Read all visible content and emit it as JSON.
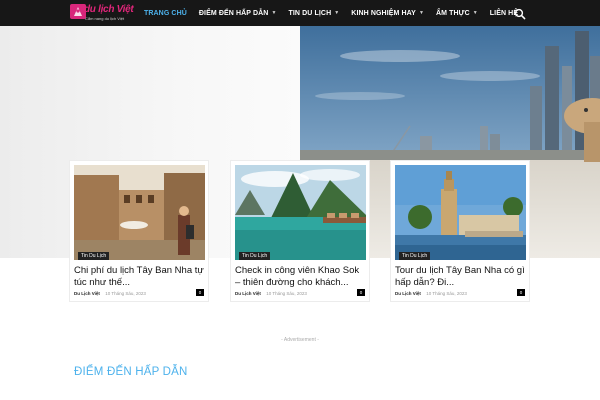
{
  "header": {
    "logo": {
      "name": "du lịch Việt",
      "tagline": "Cẩm nang du lịch Việt"
    },
    "menu": [
      {
        "label": "TRANG CHỦ",
        "active": true,
        "has_dropdown": false
      },
      {
        "label": "ĐIỂM ĐẾN HẤP DẪN",
        "active": false,
        "has_dropdown": true
      },
      {
        "label": "TIN DU LỊCH",
        "active": false,
        "has_dropdown": true
      },
      {
        "label": "KINH NGHIỆM HAY",
        "active": false,
        "has_dropdown": true
      },
      {
        "label": "ẨM THỰC",
        "active": false,
        "has_dropdown": true
      },
      {
        "label": "LIÊN HỆ",
        "active": false,
        "has_dropdown": false
      }
    ],
    "search_icon": "search-icon"
  },
  "cards": [
    {
      "category": "Tin Du Lịch",
      "title": "Chi phí du lịch Tây Ban Nha tự túc như thế...",
      "author": "Du Lịch Việt",
      "date": "10 Tháng Sáu, 2023",
      "comments": "0"
    },
    {
      "category": "Tin Du Lịch",
      "title": "Check in công viên Khao Sok – thiên đường cho khách...",
      "author": "Du Lịch Việt",
      "date": "10 Tháng Sáu, 2023",
      "comments": "0"
    },
    {
      "category": "Tin Du Lịch",
      "title": "Tour du lịch Tây Ban Nha có gì hấp dẫn? Đi...",
      "author": "Du Lịch Việt",
      "date": "10 Tháng Sáu, 2023",
      "comments": "0"
    }
  ],
  "advertisement": "- Advertisement -",
  "section_title": "ĐIỂM ĐẾN HẤP DẪN",
  "colors": {
    "nav_bg": "#171717",
    "accent": "#4db2ec",
    "brand": "#e0267a"
  }
}
